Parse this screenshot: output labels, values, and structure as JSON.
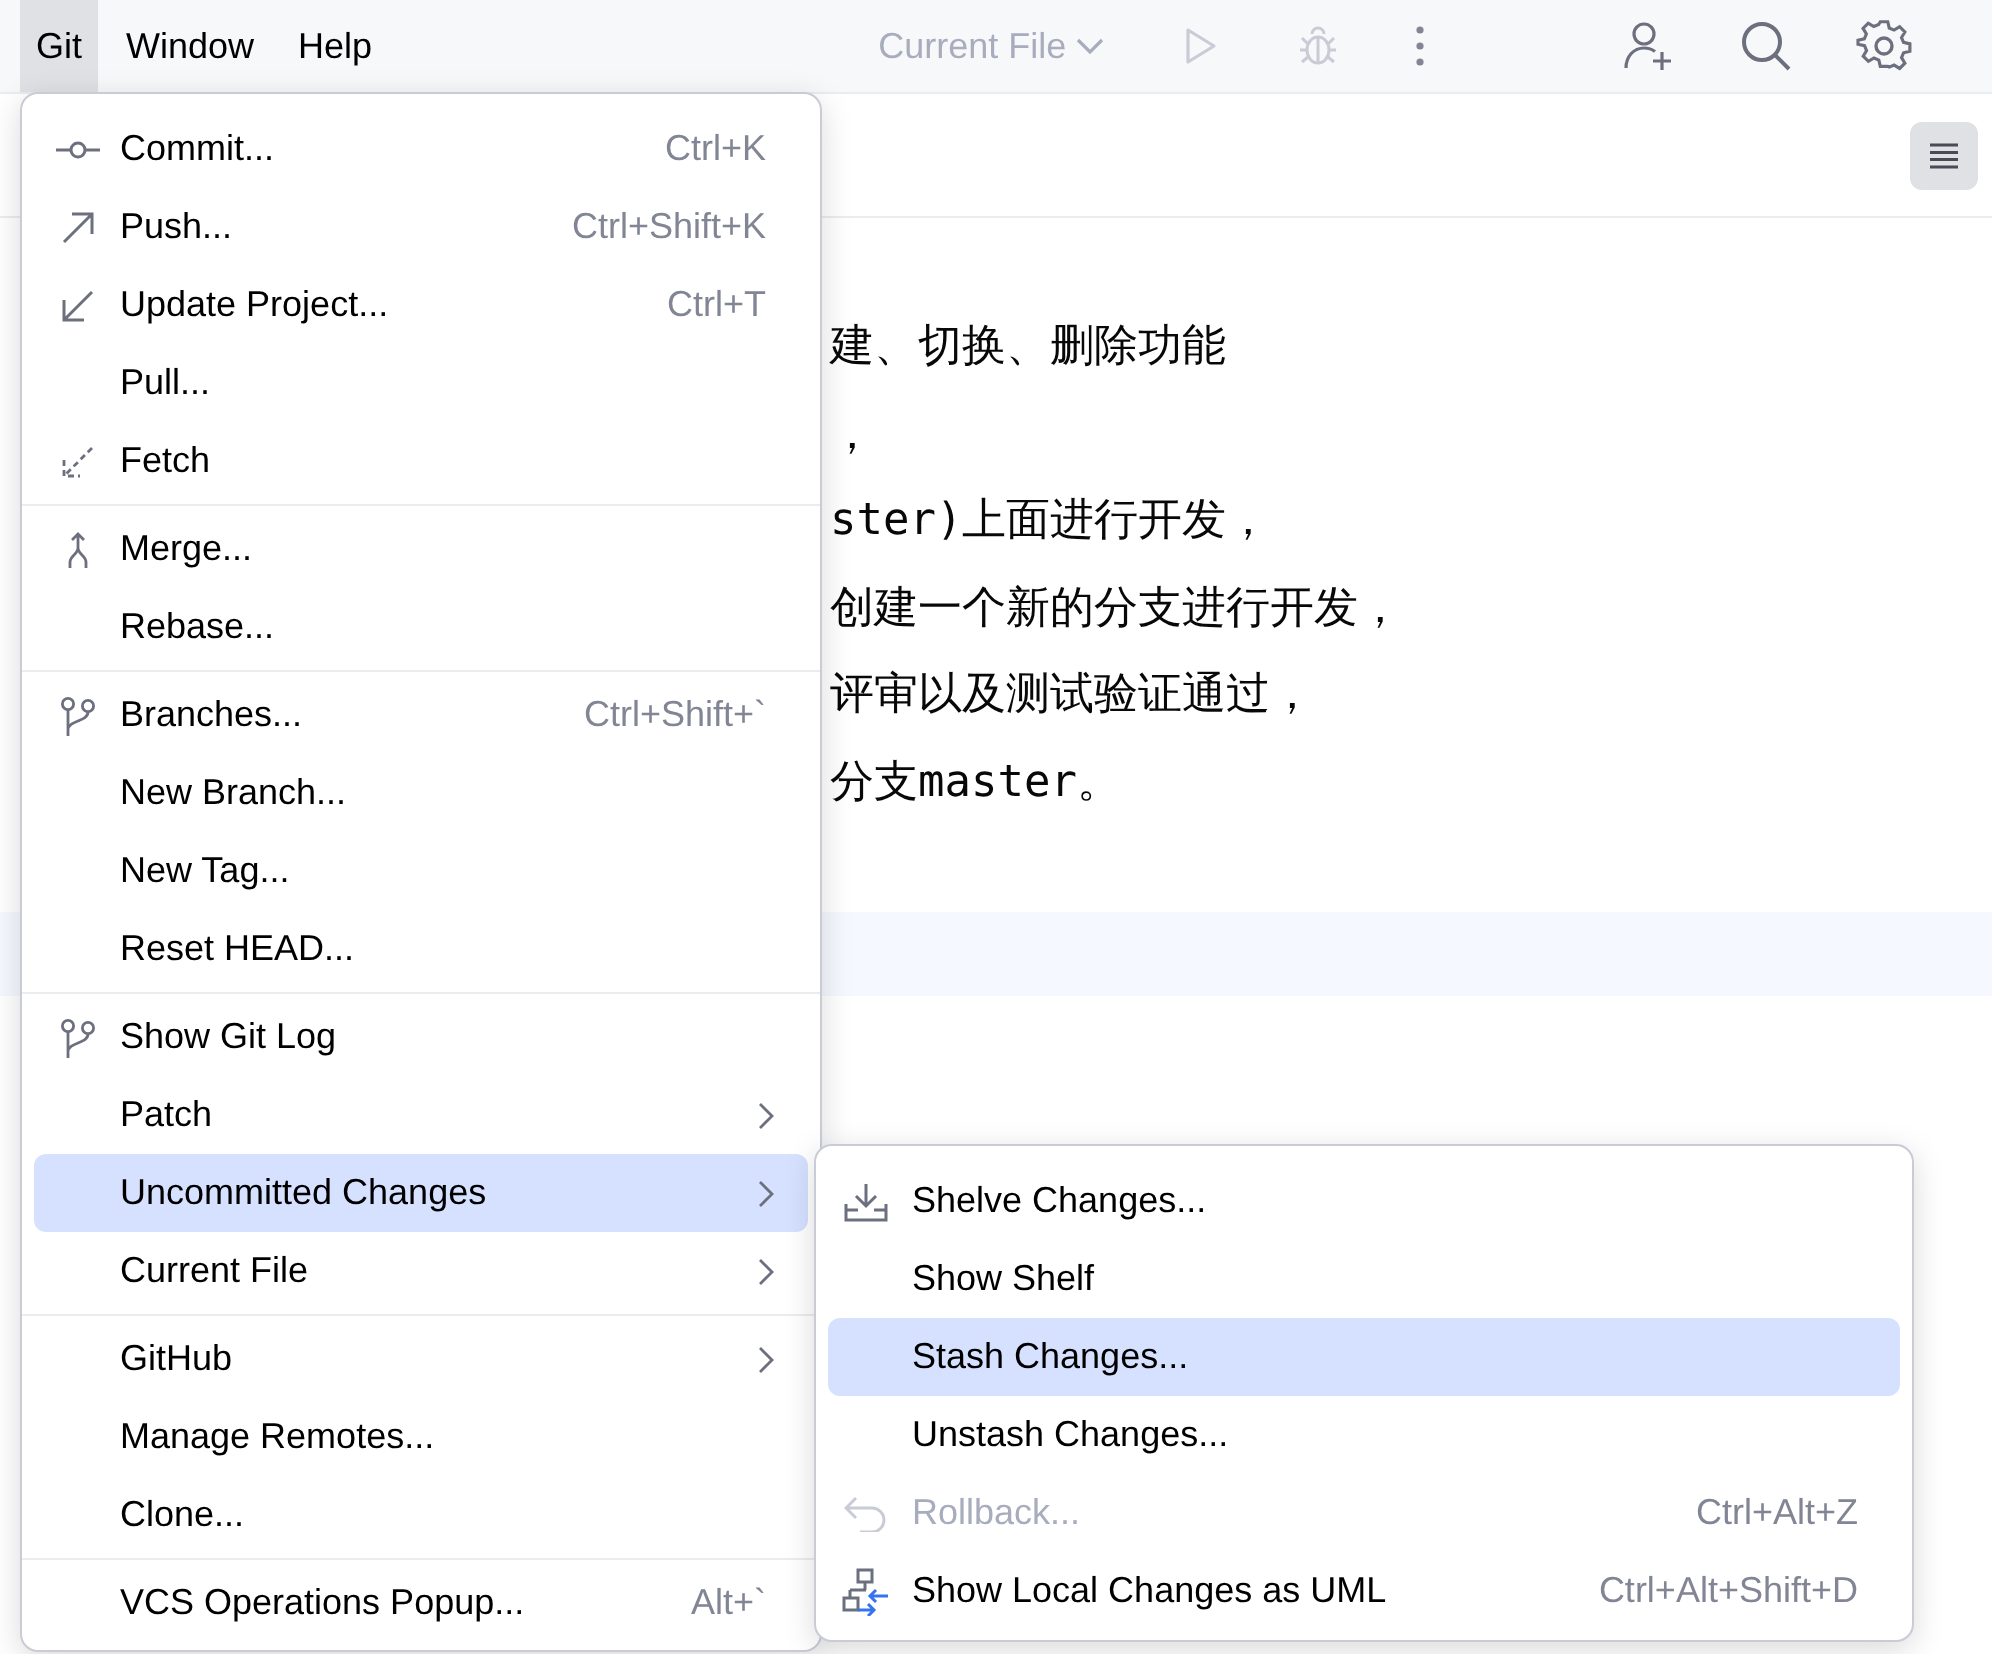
{
  "menubar": [
    {
      "label": "Git",
      "selected": true
    },
    {
      "label": "Window",
      "selected": false
    },
    {
      "label": "Help",
      "selected": false
    }
  ],
  "toolbar": {
    "run_configuration": "Current File"
  },
  "editor": {
    "lines": [
      "建、切换、删除功能",
      "，",
      "ster)上面进行开发，",
      "创建一个新的分支进行开发，",
      "评审以及测试验证通过，",
      "分支master。"
    ]
  },
  "git_menu": {
    "groups": [
      [
        {
          "label": "Commit...",
          "shortcut": "Ctrl+K",
          "kind": "commit",
          "submenu": false,
          "selected": false
        },
        {
          "label": "Push...",
          "shortcut": "Ctrl+Shift+K",
          "kind": "push",
          "submenu": false,
          "selected": false
        },
        {
          "label": "Update Project...",
          "shortcut": "Ctrl+T",
          "kind": "update",
          "submenu": false,
          "selected": false
        },
        {
          "label": "Pull...",
          "submenu": false,
          "selected": false
        },
        {
          "label": "Fetch",
          "kind": "fetch",
          "submenu": false,
          "selected": false
        }
      ],
      [
        {
          "label": "Merge...",
          "kind": "merge",
          "submenu": false,
          "selected": false
        },
        {
          "label": "Rebase...",
          "submenu": false,
          "selected": false
        }
      ],
      [
        {
          "label": "Branches...",
          "shortcut": "Ctrl+Shift+`",
          "kind": "branch",
          "submenu": false,
          "selected": false
        },
        {
          "label": "New Branch...",
          "submenu": false,
          "selected": false
        },
        {
          "label": "New Tag...",
          "submenu": false,
          "selected": false
        },
        {
          "label": "Reset HEAD...",
          "submenu": false,
          "selected": false
        }
      ],
      [
        {
          "label": "Show Git Log",
          "kind": "branch",
          "submenu": false,
          "selected": false
        },
        {
          "label": "Patch",
          "submenu": true,
          "selected": false
        },
        {
          "label": "Uncommitted Changes",
          "submenu": true,
          "selected": true
        },
        {
          "label": "Current File",
          "submenu": true,
          "selected": false
        }
      ],
      [
        {
          "label": "GitHub",
          "submenu": true,
          "selected": false
        },
        {
          "label": "Manage Remotes...",
          "submenu": false,
          "selected": false
        },
        {
          "label": "Clone...",
          "submenu": false,
          "selected": false
        }
      ],
      [
        {
          "label": "VCS Operations Popup...",
          "shortcut": "Alt+`",
          "submenu": false,
          "selected": false
        }
      ]
    ]
  },
  "submenu": {
    "items": [
      {
        "label": "Shelve Changes...",
        "kind": "shelve",
        "selected": false,
        "disabled": false
      },
      {
        "label": "Show Shelf",
        "selected": false,
        "disabled": false
      },
      {
        "label": "Stash Changes...",
        "selected": true,
        "disabled": false
      },
      {
        "label": "Unstash Changes...",
        "selected": false,
        "disabled": false
      },
      {
        "label": "Rollback...",
        "shortcut": "Ctrl+Alt+Z",
        "kind": "rollback",
        "selected": false,
        "disabled": true
      },
      {
        "label": "Show Local Changes as UML",
        "shortcut": "Ctrl+Alt+Shift+D",
        "kind": "uml",
        "selected": false,
        "disabled": false
      }
    ]
  }
}
